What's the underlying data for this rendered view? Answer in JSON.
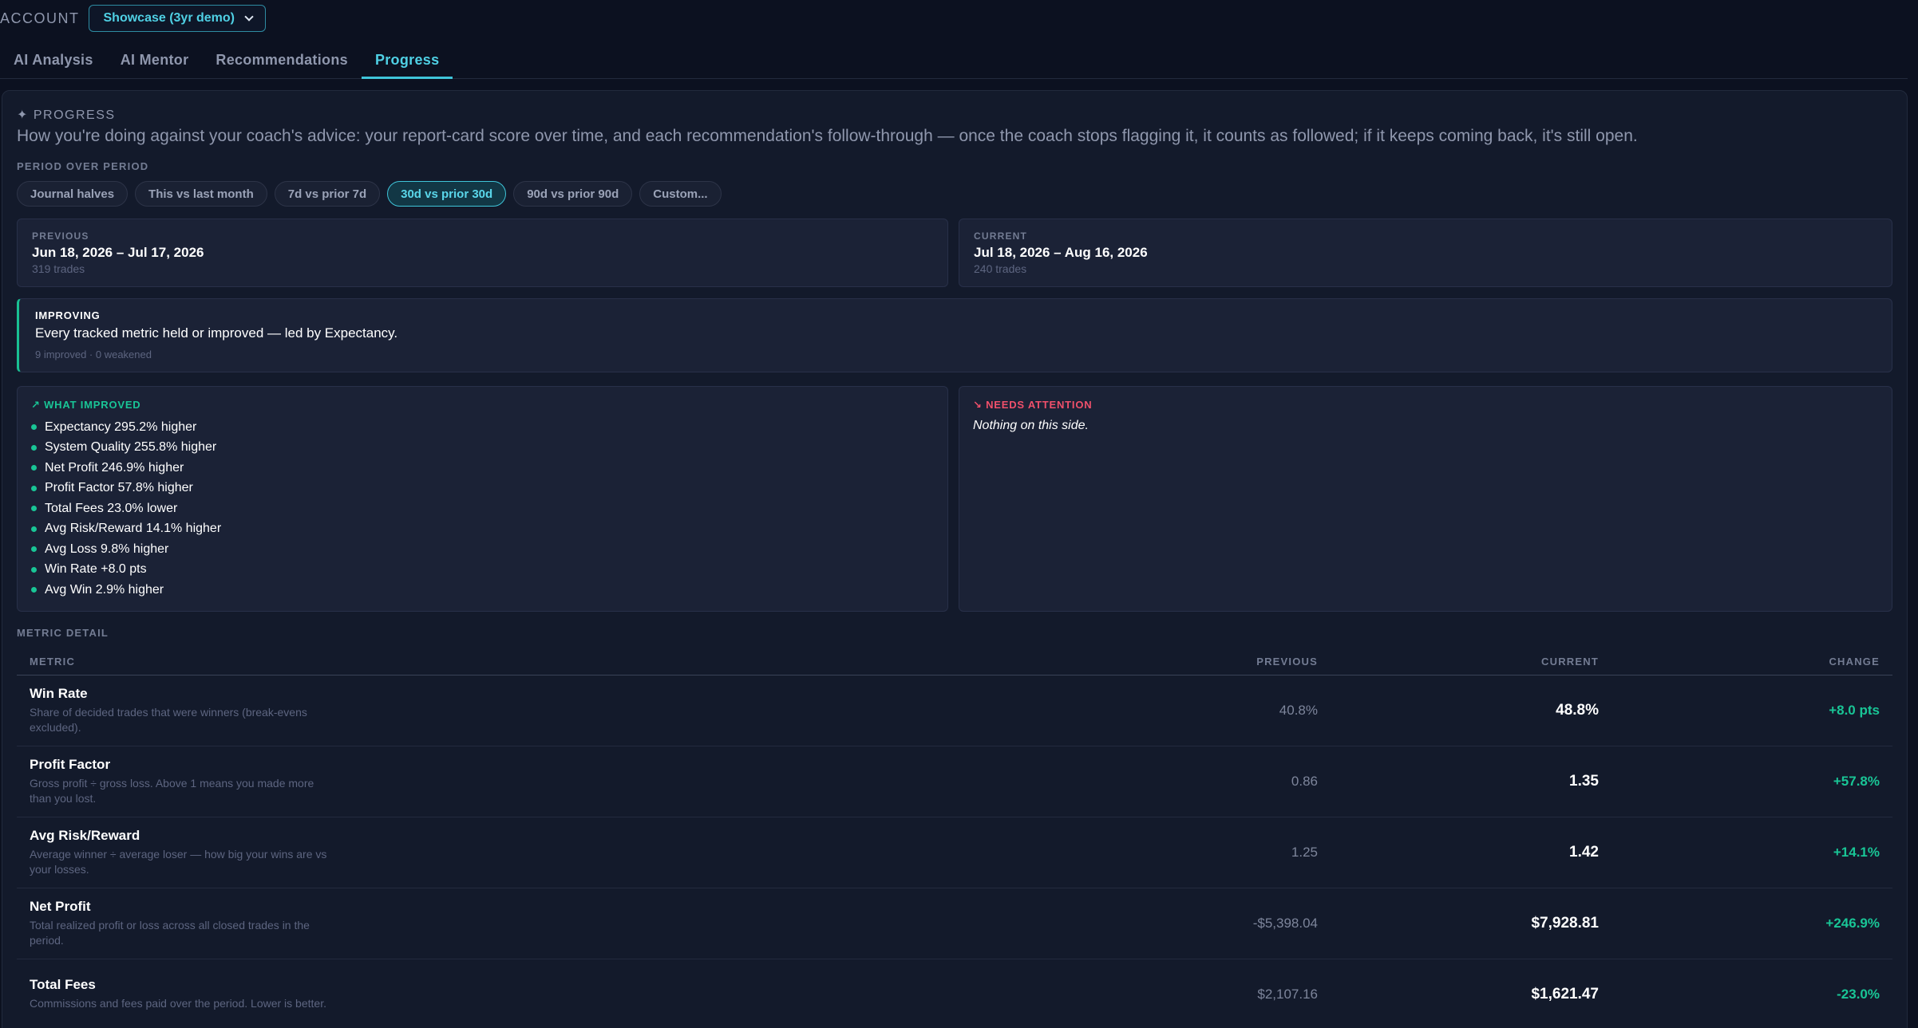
{
  "account": {
    "label": "ACCOUNT",
    "selected": "Showcase (3yr demo)"
  },
  "tabs": [
    {
      "label": "AI Analysis",
      "active": false
    },
    {
      "label": "AI Mentor",
      "active": false
    },
    {
      "label": "Recommendations",
      "active": false
    },
    {
      "label": "Progress",
      "active": true
    }
  ],
  "progress": {
    "title": "✦ PROGRESS",
    "intro": "How you're doing against your coach's advice: your report-card score over time, and each recommendation's follow-through — once the coach stops flagging it, it counts as followed; if it keeps coming back, it's still open.",
    "period_label": "PERIOD OVER PERIOD",
    "chips": [
      {
        "label": "Journal halves",
        "active": false
      },
      {
        "label": "This vs last month",
        "active": false
      },
      {
        "label": "7d vs prior 7d",
        "active": false
      },
      {
        "label": "30d vs prior 30d",
        "active": true
      },
      {
        "label": "90d vs prior 90d",
        "active": false
      },
      {
        "label": "Custom...",
        "active": false
      }
    ],
    "previous": {
      "label": "PREVIOUS",
      "range": "Jun 18, 2026 – Jul 17, 2026",
      "trades": "319 trades"
    },
    "current": {
      "label": "CURRENT",
      "range": "Jul 18, 2026 – Aug 16, 2026",
      "trades": "240 trades"
    },
    "status": {
      "label": "IMPROVING",
      "message": "Every tracked metric held or improved — led by Expectancy.",
      "counts": "9 improved · 0 weakened"
    },
    "improved": {
      "heading": "↗ WHAT IMPROVED",
      "items": [
        "Expectancy 295.2% higher",
        "System Quality 255.8% higher",
        "Net Profit 246.9% higher",
        "Profit Factor 57.8% higher",
        "Total Fees 23.0% lower",
        "Avg Risk/Reward 14.1% higher",
        "Avg Loss 9.8% higher",
        "Win Rate +8.0 pts",
        "Avg Win 2.9% higher"
      ]
    },
    "attention": {
      "heading": "↘ NEEDS ATTENTION",
      "empty": "Nothing on this side."
    },
    "metric_detail": {
      "label": "METRIC DETAIL",
      "columns": [
        "METRIC",
        "PREVIOUS",
        "CURRENT",
        "CHANGE"
      ],
      "rows": [
        {
          "name": "Win Rate",
          "desc": "Share of decided trades that were winners (break-evens excluded).",
          "previous": "40.8%",
          "current": "48.8%",
          "change": "+8.0 pts"
        },
        {
          "name": "Profit Factor",
          "desc": "Gross profit ÷ gross loss. Above 1 means you made more than you lost.",
          "previous": "0.86",
          "current": "1.35",
          "change": "+57.8%"
        },
        {
          "name": "Avg Risk/Reward",
          "desc": "Average winner ÷ average loser — how big your wins are vs your losses.",
          "previous": "1.25",
          "current": "1.42",
          "change": "+14.1%"
        },
        {
          "name": "Net Profit",
          "desc": "Total realized profit or loss across all closed trades in the period.",
          "previous": "-$5,398.04",
          "current": "$7,928.81",
          "change": "+246.9%"
        },
        {
          "name": "Total Fees",
          "desc": "Commissions and fees paid over the period. Lower is better.",
          "previous": "$2,107.16",
          "current": "$1,621.47",
          "change": "-23.0%"
        }
      ]
    }
  }
}
